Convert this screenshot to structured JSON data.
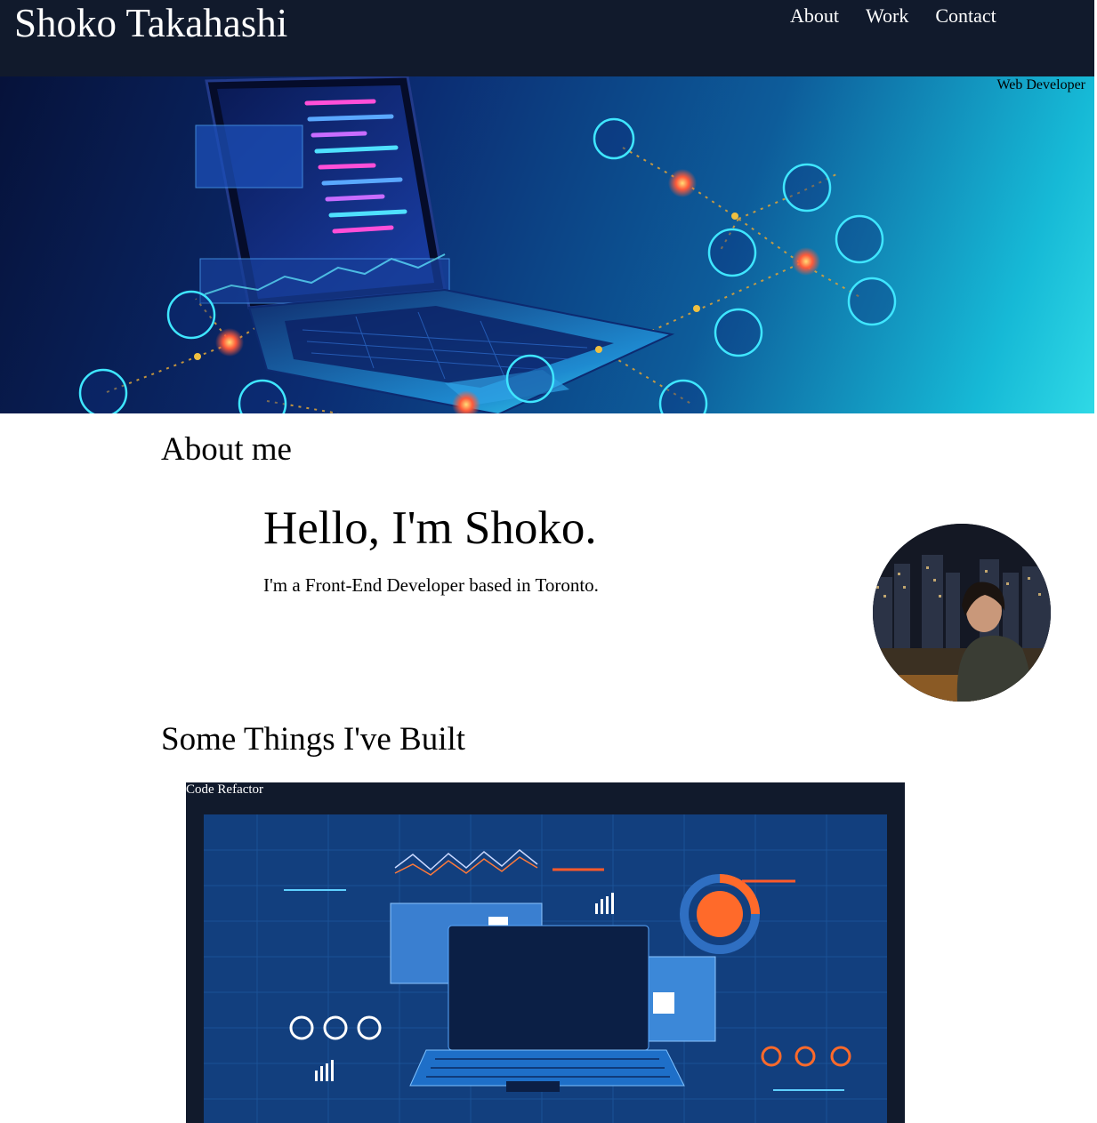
{
  "header": {
    "site_title": "Shoko Takahashi",
    "nav": [
      {
        "label": "About"
      },
      {
        "label": "Work"
      },
      {
        "label": "Contact"
      }
    ]
  },
  "hero": {
    "caption": "Web Developer"
  },
  "about": {
    "heading": "About me",
    "greeting": "Hello, I'm Shoko.",
    "intro": "I'm a Front-End Developer based in Toronto."
  },
  "work": {
    "heading": "Some Things I've Built",
    "projects": [
      {
        "label": "Code Refactor"
      }
    ]
  },
  "colors": {
    "header_bg": "#111a2c",
    "hero_gradient_start": "#06123a",
    "hero_gradient_end": "#2fd9e6",
    "project_bg": "#111a2c",
    "accent_orange": "#ff6a2a",
    "accent_cyan": "#3fe6ff"
  }
}
